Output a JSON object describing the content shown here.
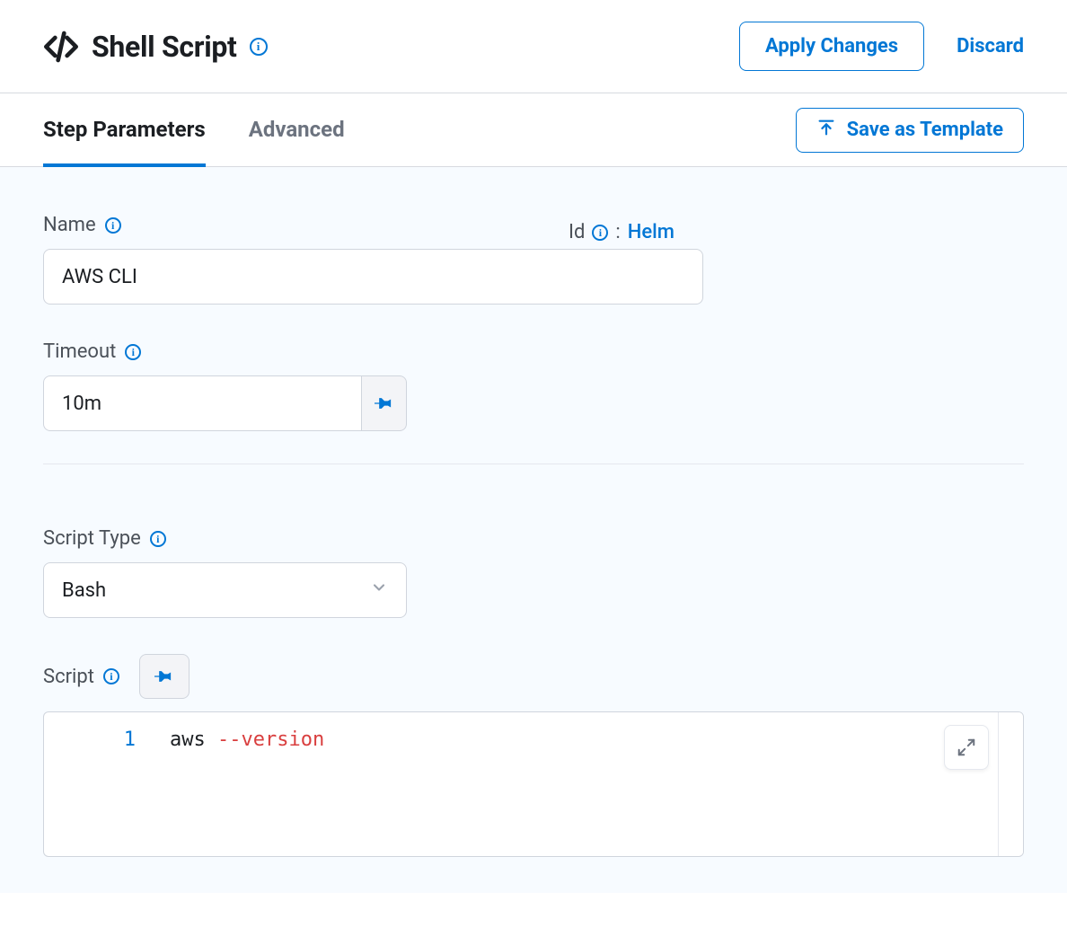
{
  "header": {
    "title": "Shell Script",
    "apply_label": "Apply Changes",
    "discard_label": "Discard"
  },
  "tabs": {
    "step_parameters": "Step Parameters",
    "advanced": "Advanced",
    "save_template_label": "Save as Template"
  },
  "form": {
    "name_label": "Name",
    "name_value": "AWS CLI",
    "id_label": "Id",
    "id_separator": ":",
    "id_value": "Helm",
    "timeout_label": "Timeout",
    "timeout_value": "10m",
    "script_type_label": "Script Type",
    "script_type_value": "Bash",
    "script_label": "Script"
  },
  "editor": {
    "line_number": "1",
    "token_cmd": "aws ",
    "token_flag": "--version"
  }
}
